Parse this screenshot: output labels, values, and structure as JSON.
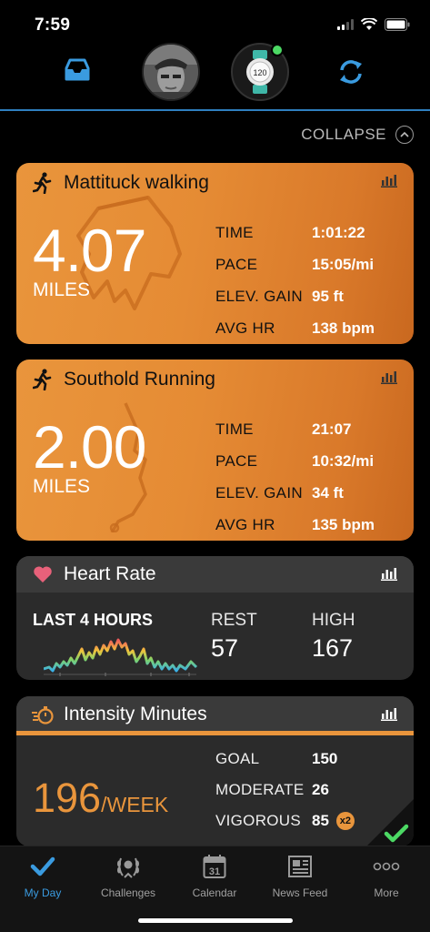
{
  "status_bar": {
    "time": "7:59"
  },
  "header": {
    "inbox_icon": "inbox-tray-icon",
    "sync_icon": "sync-icon",
    "device_screen_text": "120"
  },
  "collapse_label": "COLLAPSE",
  "activities": [
    {
      "title": "Mattituck walking",
      "distance": "4.07",
      "unit": "MILES",
      "stats": [
        {
          "label": "TIME",
          "value": "1:01:22"
        },
        {
          "label": "PACE",
          "value": "15:05/mi"
        },
        {
          "label": "ELEV. GAIN",
          "value": "95 ft"
        },
        {
          "label": "AVG HR",
          "value": "138 bpm"
        }
      ]
    },
    {
      "title": "Southold Running",
      "distance": "2.00",
      "unit": "MILES",
      "stats": [
        {
          "label": "TIME",
          "value": "21:07"
        },
        {
          "label": "PACE",
          "value": "10:32/mi"
        },
        {
          "label": "ELEV. GAIN",
          "value": "34 ft"
        },
        {
          "label": "AVG HR",
          "value": "135 bpm"
        }
      ]
    }
  ],
  "heart_rate": {
    "title": "Heart Rate",
    "period": "LAST 4 HOURS",
    "rest_label": "REST",
    "rest_value": "57",
    "high_label": "HIGH",
    "high_value": "167"
  },
  "intensity": {
    "title": "Intensity Minutes",
    "value": "196",
    "unit": "/WEEK",
    "goal_label": "GOAL",
    "goal_value": "150",
    "moderate_label": "MODERATE",
    "moderate_value": "26",
    "vigorous_label": "VIGOROUS",
    "vigorous_value": "85",
    "multiplier": "x2"
  },
  "tabs": [
    {
      "label": "My Day",
      "icon": "checkmark-icon",
      "active": true
    },
    {
      "label": "Challenges",
      "icon": "laurel-icon",
      "active": false
    },
    {
      "label": "Calendar",
      "icon": "calendar-icon",
      "calendar_day": "31",
      "active": false
    },
    {
      "label": "News Feed",
      "icon": "newspaper-icon",
      "active": false
    },
    {
      "label": "More",
      "icon": "more-dots-icon",
      "active": false
    }
  ],
  "colors": {
    "accent_orange": "#e9953c",
    "accent_blue": "#3a9be0",
    "heart_pink": "#e8617a",
    "check_green": "#4cd964"
  }
}
